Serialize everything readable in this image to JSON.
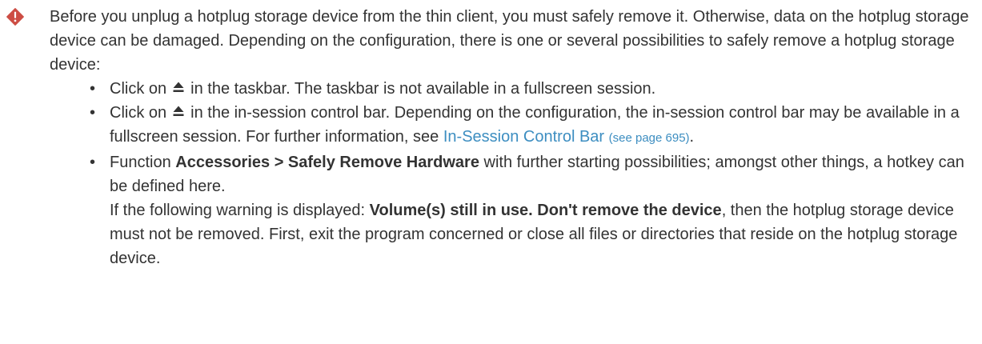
{
  "icons": {
    "warning": "warning-diamond-icon",
    "eject": "eject-icon"
  },
  "colors": {
    "text": "#333333",
    "warning_icon": "#cd4d44",
    "link": "#3d8ec1"
  },
  "note": {
    "intro": "Before you unplug a hotplug storage device from the thin client, you must safely remove it. Otherwise, data on the hotplug storage device can be damaged. Depending on the configuration, there is one or several possibilities to safely remove a hotplug storage device:",
    "bullet_glyph": "•",
    "item1": {
      "prefix": "Click on",
      "suffix": "in the taskbar. The taskbar is not available in a fullscreen session."
    },
    "item2": {
      "prefix": "Click on",
      "suffix": "in the in-session control bar. Depending on the configuration, the in-session control bar may be available in a fullscreen session. For further information, see",
      "link_text": "In-Session Control Bar",
      "page_ref": "(see page 695)",
      "end": "."
    },
    "item3": {
      "prefix": "Function",
      "bold": "Accessories > Safely Remove Hardware",
      "suffix": "with further starting possibilities; amongst other things, a hotkey can be defined here.",
      "warning_prefix": "If the following warning is displayed:",
      "warning_bold": "Volume(s) still in use. Don't remove the device",
      "warning_suffix": ", then the hotplug storage device must not be removed. First, exit the program concerned or close all files or directories that reside on the hotplug storage device."
    }
  }
}
